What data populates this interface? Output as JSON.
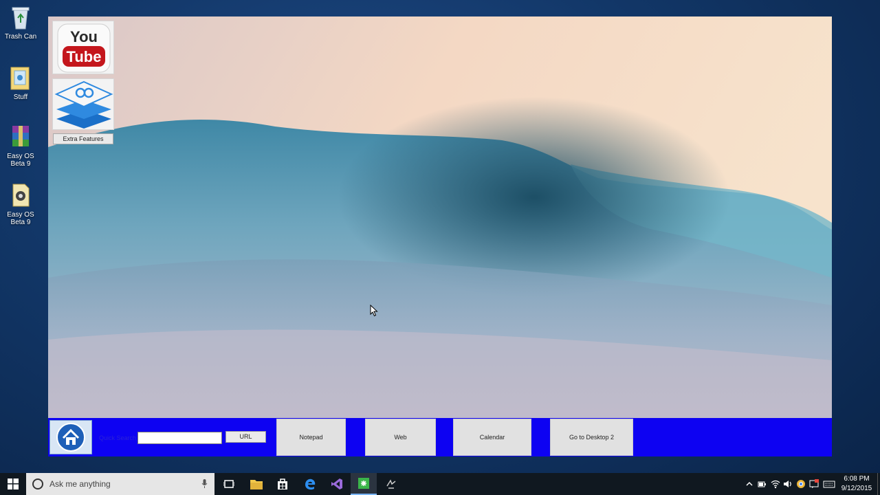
{
  "desktop": {
    "icons": [
      {
        "label": "Trash Can",
        "icon": "recycle-bin-icon"
      },
      {
        "label": "Stuff",
        "icon": "folder-icon"
      },
      {
        "label": "Easy OS Beta 9",
        "icon": "winrar-archive-icon"
      },
      {
        "label": "Easy OS Beta 9",
        "icon": "application-icon"
      }
    ]
  },
  "app": {
    "tiles": {
      "youtube": {
        "line1": "You",
        "line2": "Tube",
        "icon": "youtube-logo"
      },
      "extra_features": {
        "icon": "layered-stack-icon",
        "button_label": "Extra Features"
      }
    },
    "bottom_bar": {
      "color": "#0d02f2",
      "home_icon": "home-icon",
      "quick_search_label": "Quick Search",
      "search_value": "",
      "url_label": "URL",
      "notepad_label": "Notepad",
      "web_label": "Web",
      "calendar_label": "Calendar",
      "desktop2_label": "Go to Desktop 2"
    }
  },
  "taskbar": {
    "search_placeholder": "Ask me anything",
    "pinned": [
      "task-view-icon",
      "file-explorer-icon",
      "store-icon",
      "edge-icon",
      "visual-studio-icon",
      "easy-os-app-icon",
      "misc-app-icon"
    ],
    "active_app": "easy-os-app-icon",
    "tray": [
      "chevron-up-icon",
      "power-icon",
      "network-icon",
      "volume-icon",
      "action-center-icon",
      "chrome-icon",
      "notification-icon",
      "keyboard-icon"
    ],
    "time": "6:08 PM",
    "date": "9/12/2015"
  }
}
